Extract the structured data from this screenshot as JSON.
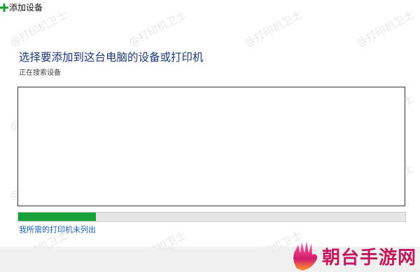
{
  "window": {
    "title": "添加设备",
    "icon": "add-device-plus-icon"
  },
  "main": {
    "heading": "选择要添加到这台电脑的设备或打印机",
    "status": "正在搜索设备",
    "device_list": [],
    "progress": 0.2,
    "progress_color": "#17a33a",
    "printer_not_listed_link": "我所需的打印机未列出"
  },
  "watermark": {
    "text": "@打印机卫士"
  },
  "brand": {
    "text": "朝台手游网",
    "color": "#c2185b"
  }
}
